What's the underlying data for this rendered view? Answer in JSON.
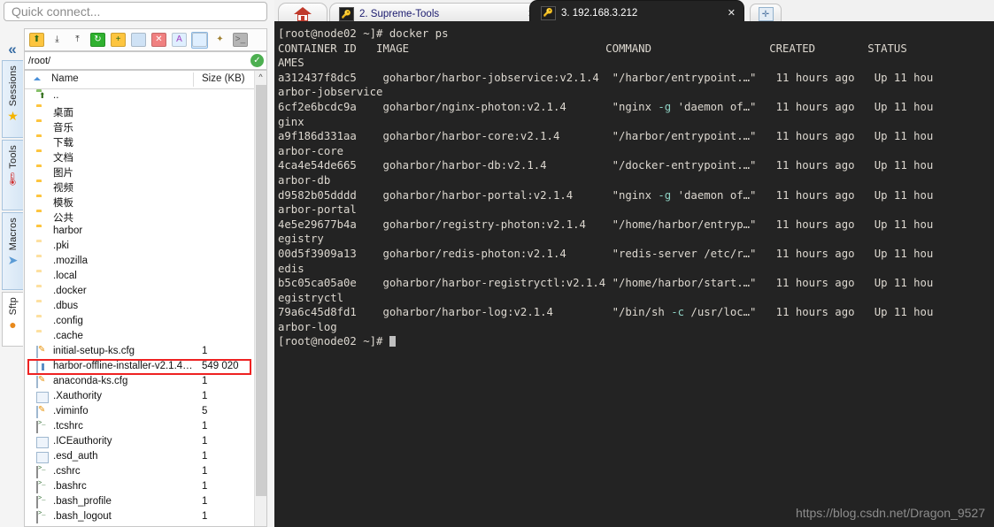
{
  "quick_connect": {
    "placeholder": "Quick connect...",
    "value": ""
  },
  "side_tabs": [
    {
      "label": "Sessions",
      "icon": "star-icon",
      "glyph": "★",
      "color": "#f4b400",
      "active": false
    },
    {
      "label": "Tools",
      "icon": "thermometer-icon",
      "glyph": "🌡",
      "color": "#d03030",
      "active": false
    },
    {
      "label": "Macros",
      "icon": "paper-plane-icon",
      "glyph": "➤",
      "color": "#5b9bd5",
      "active": false
    },
    {
      "label": "Sftp",
      "icon": "globe-icon",
      "glyph": "●",
      "color": "#e8891c",
      "active": true
    }
  ],
  "collapse_label": "«",
  "toolbar": {
    "buttons": [
      {
        "name": "go-up-icon",
        "glyph": "⬆",
        "fg": "#2d6b16",
        "bg": "#fdc53f",
        "selected": false
      },
      {
        "name": "download-icon",
        "glyph": "⤓",
        "fg": "#333333",
        "bg": "transparent",
        "selected": false
      },
      {
        "name": "upload-icon",
        "glyph": "⤒",
        "fg": "#333333",
        "bg": "transparent",
        "selected": false
      },
      {
        "name": "refresh-icon",
        "glyph": "↻",
        "fg": "#ffffff",
        "bg": "#2fb12f",
        "selected": false
      },
      {
        "name": "new-folder-icon",
        "glyph": "+",
        "fg": "#2d6b16",
        "bg": "#fdc53f",
        "selected": false
      },
      {
        "name": "new-file-icon",
        "glyph": "",
        "fg": "#6e9ac4",
        "bg": "#cfe2f5",
        "selected": false
      },
      {
        "name": "delete-icon",
        "glyph": "✕",
        "fg": "#ffffff",
        "bg": "#f08080",
        "selected": false
      },
      {
        "name": "text-mode-icon",
        "glyph": "A",
        "fg": "#a040c0",
        "bg": "#dfefff",
        "selected": false
      },
      {
        "name": "binary-mode-icon",
        "glyph": "",
        "fg": "#2a4f8f",
        "bg": "#dfefff",
        "selected": true
      },
      {
        "name": "magic-wand-icon",
        "glyph": "✦",
        "fg": "#a08030",
        "bg": "transparent",
        "selected": false
      },
      {
        "name": "terminal-icon",
        "glyph": ">_",
        "fg": "#666666",
        "bg": "#b5b5b5",
        "selected": false
      }
    ]
  },
  "path_bar": {
    "value": "/root/",
    "status_icon": "check-icon",
    "status_glyph": "✓"
  },
  "file_list": {
    "columns": {
      "name": "Name",
      "size": "Size (KB)"
    },
    "rows": [
      {
        "name": "..",
        "size": "",
        "icon": "up-folder-icon",
        "kind": "up"
      },
      {
        "name": "桌面",
        "size": "",
        "icon": "folder-icon",
        "kind": "folder"
      },
      {
        "name": "音乐",
        "size": "",
        "icon": "folder-icon",
        "kind": "folder"
      },
      {
        "name": "下载",
        "size": "",
        "icon": "folder-icon",
        "kind": "folder"
      },
      {
        "name": "文档",
        "size": "",
        "icon": "folder-icon",
        "kind": "folder"
      },
      {
        "name": "图片",
        "size": "",
        "icon": "folder-icon",
        "kind": "folder"
      },
      {
        "name": "视频",
        "size": "",
        "icon": "folder-icon",
        "kind": "folder"
      },
      {
        "name": "模板",
        "size": "",
        "icon": "folder-icon",
        "kind": "folder"
      },
      {
        "name": "公共",
        "size": "",
        "icon": "folder-icon",
        "kind": "folder"
      },
      {
        "name": "harbor",
        "size": "",
        "icon": "folder-icon",
        "kind": "folder"
      },
      {
        "name": ".pki",
        "size": "",
        "icon": "folder-icon",
        "kind": "folder-dim"
      },
      {
        "name": ".mozilla",
        "size": "",
        "icon": "folder-icon",
        "kind": "folder-dim"
      },
      {
        "name": ".local",
        "size": "",
        "icon": "folder-icon",
        "kind": "folder-dim"
      },
      {
        "name": ".docker",
        "size": "",
        "icon": "folder-icon",
        "kind": "folder-dim"
      },
      {
        "name": ".dbus",
        "size": "",
        "icon": "folder-icon",
        "kind": "folder-dim"
      },
      {
        "name": ".config",
        "size": "",
        "icon": "folder-icon",
        "kind": "folder-dim"
      },
      {
        "name": ".cache",
        "size": "",
        "icon": "folder-icon",
        "kind": "folder-dim"
      },
      {
        "name": "initial-setup-ks.cfg",
        "size": "1",
        "icon": "config-file-icon",
        "kind": "cfg"
      },
      {
        "name": "harbor-offline-installer-v2.1.4…",
        "size": "549 020",
        "icon": "binary-file-icon",
        "kind": "bin",
        "highlighted": true
      },
      {
        "name": "anaconda-ks.cfg",
        "size": "1",
        "icon": "config-file-icon",
        "kind": "cfg"
      },
      {
        "name": ".Xauthority",
        "size": "1",
        "icon": "file-icon",
        "kind": "file"
      },
      {
        "name": ".viminfo",
        "size": "5",
        "icon": "config-file-icon",
        "kind": "cfg"
      },
      {
        "name": ".tcshrc",
        "size": "1",
        "icon": "shell-file-icon",
        "kind": "sh"
      },
      {
        "name": ".ICEauthority",
        "size": "1",
        "icon": "file-icon",
        "kind": "file"
      },
      {
        "name": ".esd_auth",
        "size": "1",
        "icon": "file-icon",
        "kind": "file"
      },
      {
        "name": ".cshrc",
        "size": "1",
        "icon": "shell-file-icon",
        "kind": "sh"
      },
      {
        "name": ".bashrc",
        "size": "1",
        "icon": "shell-file-icon",
        "kind": "sh"
      },
      {
        "name": ".bash_profile",
        "size": "1",
        "icon": "shell-file-icon",
        "kind": "sh"
      },
      {
        "name": ".bash_logout",
        "size": "1",
        "icon": "shell-file-icon",
        "kind": "sh"
      }
    ],
    "scroll_up_glyph": "^",
    "scroll_down_glyph": "v"
  },
  "tabs": {
    "home": {
      "label": "",
      "icon": "home-icon"
    },
    "items": [
      {
        "label": "2. Supreme-Tools",
        "icon": "ssh-key-icon",
        "close": "✕",
        "active": false
      },
      {
        "label": "3. 192.168.3.212",
        "icon": "ssh-key-icon",
        "close": "✕",
        "active": true
      }
    ],
    "new_tab": {
      "icon": "new-tab-icon",
      "glyph": "✛"
    }
  },
  "terminal": {
    "colors": {
      "bg": "#232323",
      "fg": "#ddd8d0",
      "accent": "#8fd2c4"
    },
    "prompt": "[root@node02 ~]# ",
    "command": "docker ps",
    "header": "CONTAINER ID   IMAGE                              COMMAND                  CREATED        STATUS",
    "header_wrap": "AMES",
    "rows": [
      {
        "id": "a312437f8dc5",
        "image": "goharbor/harbor-jobservice:v2.1.4",
        "command_pre": "\"/harbor/entrypoint.…\"",
        "command_flag": "",
        "command_post": "",
        "created": "11 hours ago",
        "status": "Up 11 hou",
        "names_wrap": "arbor-jobservice"
      },
      {
        "id": "6cf2e6bcdc9a",
        "image": "goharbor/nginx-photon:v2.1.4",
        "command_pre": "\"nginx ",
        "command_flag": "-g",
        "command_post": " 'daemon of…\"",
        "created": "11 hours ago",
        "status": "Up 11 hou",
        "names_wrap": "ginx"
      },
      {
        "id": "a9f186d331aa",
        "image": "goharbor/harbor-core:v2.1.4",
        "command_pre": "\"/harbor/entrypoint.…\"",
        "command_flag": "",
        "command_post": "",
        "created": "11 hours ago",
        "status": "Up 11 hou",
        "names_wrap": "arbor-core"
      },
      {
        "id": "4ca4e54de665",
        "image": "goharbor/harbor-db:v2.1.4",
        "command_pre": "\"/docker-entrypoint.…\"",
        "command_flag": "",
        "command_post": "",
        "created": "11 hours ago",
        "status": "Up 11 hou",
        "names_wrap": "arbor-db"
      },
      {
        "id": "d9582b05dddd",
        "image": "goharbor/harbor-portal:v2.1.4",
        "command_pre": "\"nginx ",
        "command_flag": "-g",
        "command_post": " 'daemon of…\"",
        "created": "11 hours ago",
        "status": "Up 11 hou",
        "names_wrap": "arbor-portal"
      },
      {
        "id": "4e5e29677b4a",
        "image": "goharbor/registry-photon:v2.1.4",
        "command_pre": "\"/home/harbor/entryp…\"",
        "command_flag": "",
        "command_post": "",
        "created": "11 hours ago",
        "status": "Up 11 hou",
        "names_wrap": "egistry"
      },
      {
        "id": "00d5f3909a13",
        "image": "goharbor/redis-photon:v2.1.4",
        "command_pre": "\"redis-server /etc/r…\"",
        "command_flag": "",
        "command_post": "",
        "created": "11 hours ago",
        "status": "Up 11 hou",
        "names_wrap": "edis"
      },
      {
        "id": "b5c05ca05a0e",
        "image": "goharbor/harbor-registryctl:v2.1.4",
        "command_pre": "\"/home/harbor/start.…\"",
        "command_flag": "",
        "command_post": "",
        "created": "11 hours ago",
        "status": "Up 11 hou",
        "names_wrap": "egistryctl"
      },
      {
        "id": "79a6c45d8fd1",
        "image": "goharbor/harbor-log:v2.1.4",
        "command_pre": "\"/bin/sh ",
        "command_flag": "-c",
        "command_post": " /usr/loc…\"",
        "created": "11 hours ago",
        "status": "Up 11 hou",
        "names_wrap": "arbor-log"
      }
    ],
    "final_prompt": "[root@node02 ~]# "
  },
  "watermark": "https://blog.csdn.net/Dragon_9527"
}
